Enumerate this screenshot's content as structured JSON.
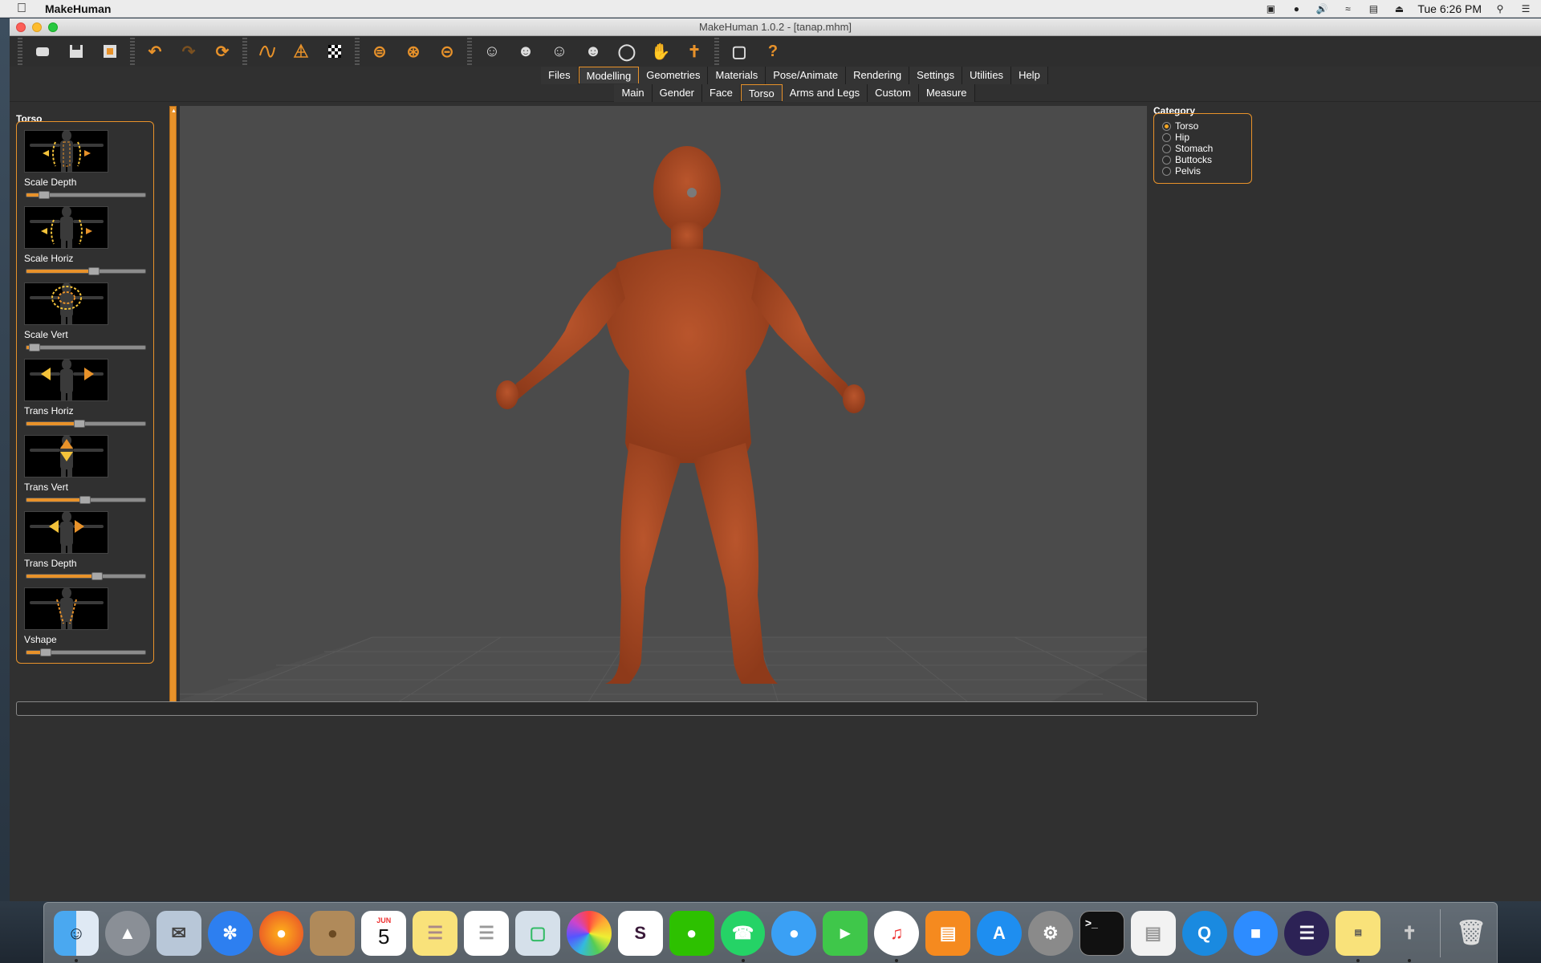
{
  "menubar": {
    "app_name": "MakeHuman",
    "clock": "Tue 6:26 PM",
    "status_icons": [
      "adobe-icon",
      "flame-icon",
      "volume-icon",
      "wifi-icon",
      "display-icon",
      "eject-icon",
      "search-icon",
      "list-icon"
    ]
  },
  "window": {
    "title": "MakeHuman 1.0.2 - [tanap.mhm]"
  },
  "toolbar": {
    "buttons": [
      "new-icon",
      "save-icon",
      "export-icon",
      "undo-icon",
      "redo-icon",
      "reset-icon",
      "smooth-icon",
      "wireframe-icon",
      "background-icon",
      "front-view-icon",
      "back-view-icon",
      "left-view-icon",
      "right-view-icon",
      "top-view-icon",
      "bottom-view-icon",
      "reset-camera-icon",
      "global-camera-icon",
      "face-camera-icon",
      "symmetry-icon",
      "screenshot-icon",
      "help-icon"
    ],
    "help_label": "?"
  },
  "tabs": {
    "main": [
      "Files",
      "Modelling",
      "Geometries",
      "Materials",
      "Pose/Animate",
      "Rendering",
      "Settings",
      "Utilities",
      "Help"
    ],
    "main_active": "Modelling",
    "sub": [
      "Main",
      "Gender",
      "Face",
      "Torso",
      "Arms and Legs",
      "Custom",
      "Measure"
    ],
    "sub_active": "Torso"
  },
  "left_panel": {
    "title": "Torso",
    "sliders": [
      {
        "label": "Scale Depth",
        "value": 0.12
      },
      {
        "label": "Scale Horiz",
        "value": 0.57
      },
      {
        "label": "Scale Vert",
        "value": 0.03
      },
      {
        "label": "Trans Horiz",
        "value": 0.44
      },
      {
        "label": "Trans Vert",
        "value": 0.49
      },
      {
        "label": "Trans Depth",
        "value": 0.6
      },
      {
        "label": "Vshape",
        "value": 0.13
      }
    ]
  },
  "right_panel": {
    "title": "Category",
    "options": [
      "Torso",
      "Hip",
      "Stomach",
      "Buttocks",
      "Pelvis"
    ],
    "selected": "Torso"
  },
  "dock": {
    "calendar_month": "JUN",
    "calendar_day": "5",
    "apps": [
      "finder-icon",
      "launchpad-icon",
      "mail-icon",
      "safari-icon",
      "firefox-icon",
      "contacts-icon",
      "calendar-icon",
      "notes-icon",
      "reminders-icon",
      "preview-icon",
      "photos-icon",
      "slack-icon",
      "wechat-icon",
      "whatsapp-icon",
      "messages-icon",
      "facetime-icon",
      "itunes-icon",
      "ibooks-icon",
      "app-store-icon",
      "system-preferences-icon",
      "terminal-icon",
      "textedit-icon",
      "quicktime-icon",
      "zoom-icon",
      "eclipse-icon",
      "stickies-icon",
      "makehuman-icon",
      "trash-icon"
    ]
  }
}
